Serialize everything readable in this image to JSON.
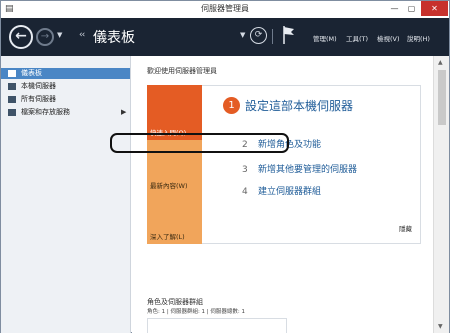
{
  "window": {
    "title": "伺服器管理員",
    "min_glyph": "—",
    "max_glyph": "▢",
    "close_glyph": "✕"
  },
  "toolbar": {
    "breadcrumb_arrows": "‹‹",
    "breadcrumb": "儀表板",
    "menu": [
      "管理(M)",
      "工具(T)",
      "檢視(V)",
      "說明(H)"
    ]
  },
  "sidebar": {
    "items": [
      {
        "label": "儀表板",
        "icon": "dashboard-icon",
        "active": true
      },
      {
        "label": "本機伺服器",
        "icon": "server-icon"
      },
      {
        "label": "所有伺服器",
        "icon": "servers-icon"
      },
      {
        "label": "檔案和存放服務",
        "icon": "storage-icon",
        "has_children": true
      }
    ]
  },
  "main": {
    "welcome": "歡迎使用伺服器管理員",
    "tiles": [
      {
        "label": "快速入門(Q)",
        "color": "#e45c24"
      },
      {
        "label": "最新內容(W)",
        "color": "#f1a55b"
      },
      {
        "label": "深入了解(L)",
        "color": "#f1a55b"
      }
    ],
    "steps": [
      {
        "num": "1",
        "label": "設定這部本機伺服器"
      },
      {
        "num": "2",
        "label": "新增角色及功能"
      },
      {
        "num": "3",
        "label": "新增其他要管理的伺服器"
      },
      {
        "num": "4",
        "label": "建立伺服器群組"
      }
    ],
    "hide": "隱藏",
    "section_title": "角色及伺服器群組",
    "section_sub": "角色: 1 | 伺服器群組: 1 | 伺服器總數: 1"
  },
  "colors": {
    "accent": "#e45c24",
    "link": "#1f5c98",
    "toolbar_bg": "#1a2433",
    "sidebar_active": "#4a86c5"
  }
}
